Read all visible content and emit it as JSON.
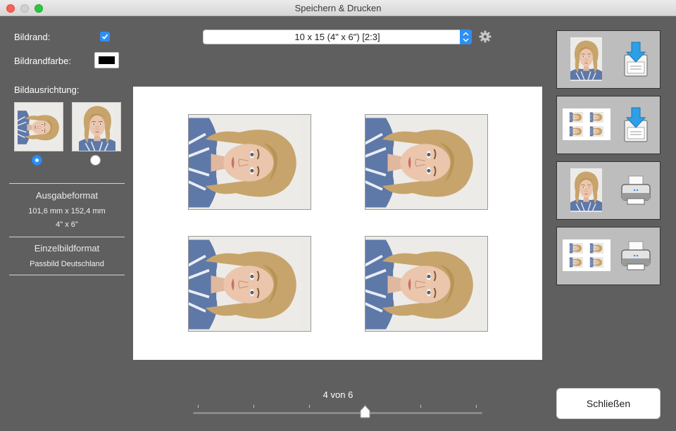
{
  "window": {
    "title": "Speichern & Drucken"
  },
  "border": {
    "label": "Bildrand:",
    "checked": true
  },
  "border_color": {
    "label": "Bildrandfarbe:",
    "value": "#000000"
  },
  "orientation": {
    "label": "Bildausrichtung:",
    "options": [
      "landscape",
      "portrait"
    ],
    "selected": "landscape"
  },
  "output_format": {
    "title": "Ausgabeformat",
    "size_mm": "101,6 mm x 152,4 mm",
    "size_in": "4\" x 6\""
  },
  "single_format": {
    "title": "Einzelbildformat",
    "value": "Passbild Deutschland"
  },
  "format_select": {
    "value": "10 x 15 (4\" x 6\") [2:3]"
  },
  "actions": [
    {
      "name": "save-single",
      "icon": "download-icon"
    },
    {
      "name": "save-sheet",
      "icon": "download-icon"
    },
    {
      "name": "print-single",
      "icon": "printer-icon"
    },
    {
      "name": "print-sheet",
      "icon": "printer-icon"
    }
  ],
  "pager": {
    "text": "4 von 6",
    "current": 4,
    "total": 6
  },
  "close_label": "Schließen",
  "colors": {
    "accent": "#2d8ff5",
    "background": "#5f5f5f",
    "paper": "#ffffff"
  }
}
